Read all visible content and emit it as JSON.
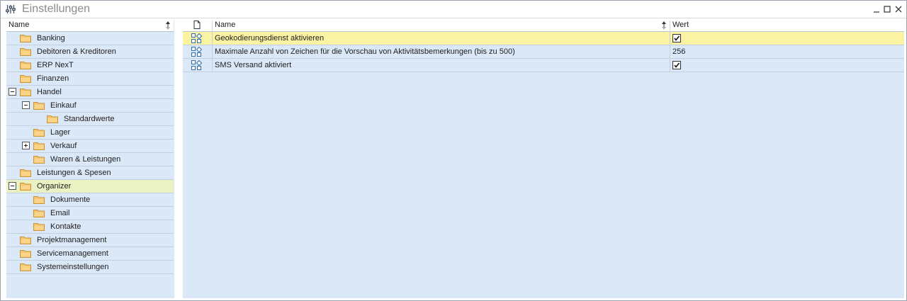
{
  "window": {
    "title": "Einstellungen"
  },
  "tree": {
    "header": "Name",
    "items": [
      {
        "label": "Banking"
      },
      {
        "label": "Debitoren & Kreditoren"
      },
      {
        "label": "ERP NexT"
      },
      {
        "label": "Finanzen"
      },
      {
        "label": "Handel",
        "expander": "minus"
      },
      {
        "label": "Einkauf",
        "expander": "minus"
      },
      {
        "label": "Standardwerte"
      },
      {
        "label": "Lager"
      },
      {
        "label": "Verkauf",
        "expander": "plus"
      },
      {
        "label": "Waren & Leistungen"
      },
      {
        "label": "Leistungen & Spesen"
      },
      {
        "label": "Organizer",
        "expander": "minus",
        "selected": true
      },
      {
        "label": "Dokumente"
      },
      {
        "label": "Email"
      },
      {
        "label": "Kontakte"
      },
      {
        "label": "Projektmanagement"
      },
      {
        "label": "Servicemanagement"
      },
      {
        "label": "Systemeinstellungen"
      }
    ]
  },
  "grid": {
    "columns": {
      "name": "Name",
      "value": "Wert"
    },
    "rows": [
      {
        "name": "Geokodierungsdienst aktivieren",
        "value_type": "checkbox",
        "checked": true,
        "selected": true
      },
      {
        "name": "Maximale Anzahl von Zeichen für die Vorschau von Aktivitätsbemerkungen (bis zu 500)",
        "value": "256",
        "value_type": "text"
      },
      {
        "name": "SMS Versand aktiviert",
        "value_type": "checkbox",
        "checked": true
      }
    ]
  },
  "colors": {
    "panel_bg": "#dbe8f8",
    "tree_selected": "#eaf2c4",
    "grid_selected": "#fbf3a4",
    "folder": "#f6c56a"
  },
  "icons": {
    "title": "settings-sliders-icon",
    "tree_item": "folder-icon",
    "grid_row": "settings-item-icon",
    "grid_header": "document-icon"
  }
}
